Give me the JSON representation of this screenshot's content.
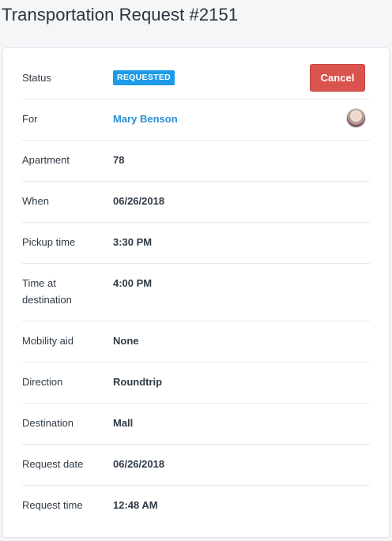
{
  "page": {
    "title": "Transportation Request #2151"
  },
  "colors": {
    "badge": "#1e9be8",
    "cancel": "#d9534f",
    "link": "#2a8fd6"
  },
  "status": {
    "label": "Status",
    "badge": "REQUESTED",
    "cancel_label": "Cancel"
  },
  "for": {
    "label": "For",
    "name": "Mary Benson",
    "avatar_icon": "user-avatar"
  },
  "fields": [
    {
      "label": "Apartment",
      "value": "78"
    },
    {
      "label": "When",
      "value": "06/26/2018"
    },
    {
      "label": "Pickup time",
      "value": "3:30 PM"
    },
    {
      "label": "Time at destination",
      "value": "4:00 PM"
    },
    {
      "label": "Mobility aid",
      "value": "None"
    },
    {
      "label": "Direction",
      "value": "Roundtrip"
    },
    {
      "label": "Destination",
      "value": "Mall"
    },
    {
      "label": "Request date",
      "value": "06/26/2018"
    },
    {
      "label": "Request time",
      "value": "12:48 AM"
    }
  ]
}
